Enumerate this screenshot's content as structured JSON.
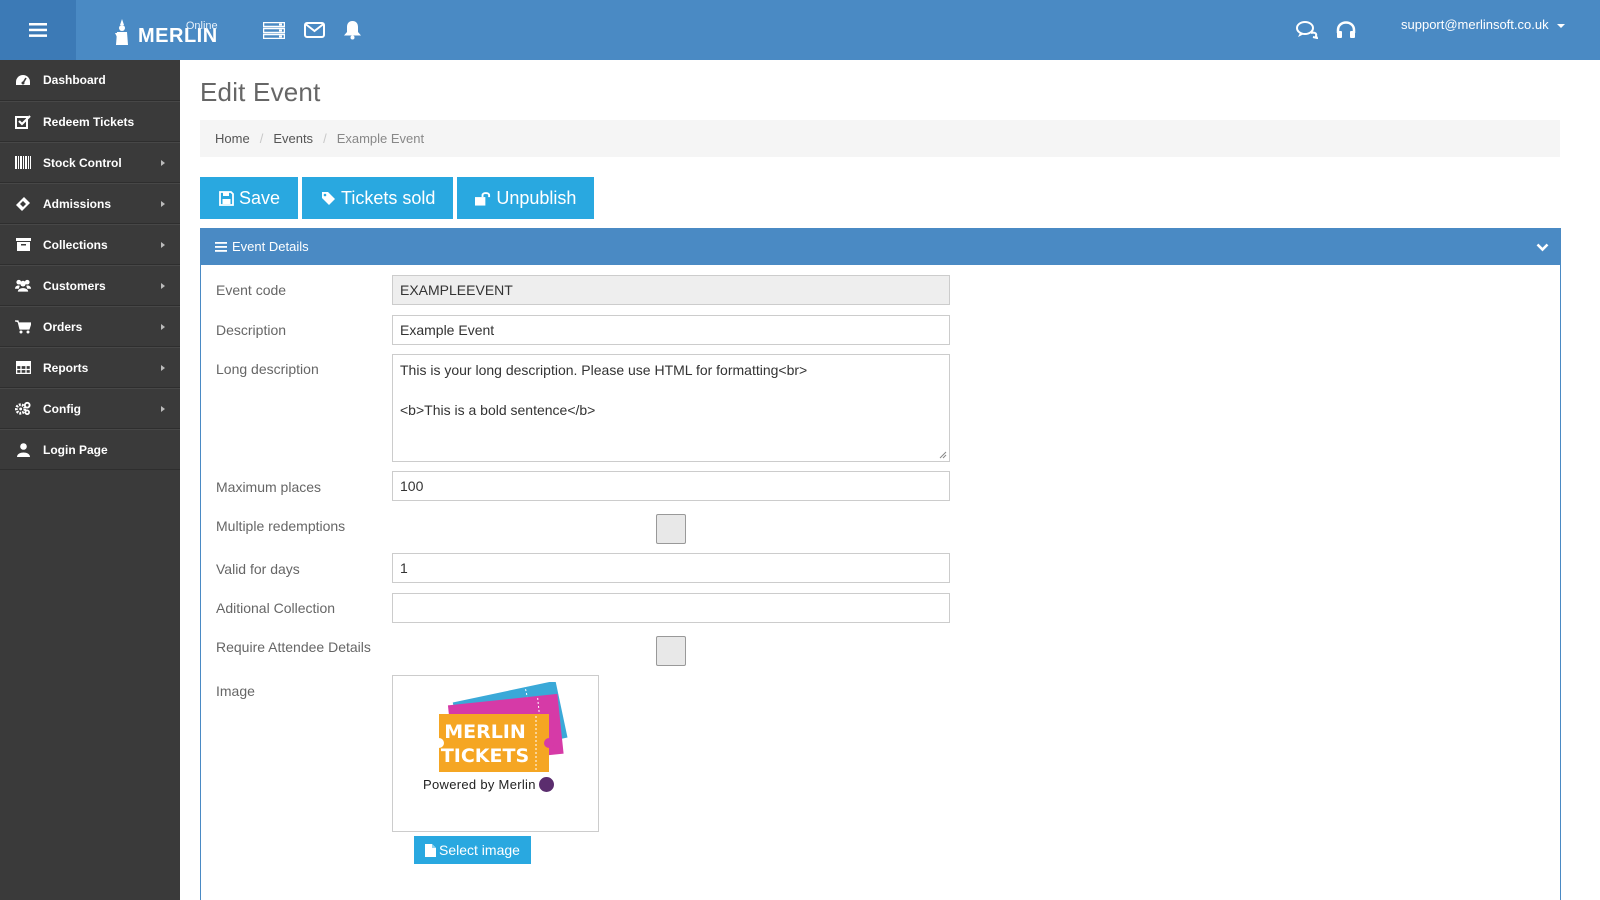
{
  "header": {
    "logo_text": "MERLIN",
    "logo_sub": "Online",
    "user_email": "support@merlinsoft.co.uk",
    "accent_color": "#4a8ac4"
  },
  "sidebar": {
    "items": [
      {
        "label": "Dashboard",
        "icon": "dashboard-icon",
        "has_submenu": false
      },
      {
        "label": "Redeem Tickets",
        "icon": "check-square-icon",
        "has_submenu": false
      },
      {
        "label": "Stock Control",
        "icon": "barcode-icon",
        "has_submenu": true
      },
      {
        "label": "Admissions",
        "icon": "ticket-icon",
        "has_submenu": true
      },
      {
        "label": "Collections",
        "icon": "archive-icon",
        "has_submenu": true
      },
      {
        "label": "Customers",
        "icon": "users-icon",
        "has_submenu": true
      },
      {
        "label": "Orders",
        "icon": "cart-icon",
        "has_submenu": true
      },
      {
        "label": "Reports",
        "icon": "table-icon",
        "has_submenu": true
      },
      {
        "label": "Config",
        "icon": "cogs-icon",
        "has_submenu": true
      },
      {
        "label": "Login Page",
        "icon": "user-icon",
        "has_submenu": false
      }
    ]
  },
  "page": {
    "title": "Edit Event",
    "breadcrumb": [
      "Home",
      "Events",
      "Example Event"
    ]
  },
  "toolbar": {
    "save_label": "Save",
    "tickets_label": "Tickets sold",
    "unpublish_label": "Unpublish",
    "button_color": "#29a8e0"
  },
  "panel": {
    "title": "Event Details"
  },
  "form": {
    "event_code": {
      "label": "Event code",
      "value": "EXAMPLEEVENT"
    },
    "description": {
      "label": "Description",
      "value": "Example Event"
    },
    "long_description": {
      "label": "Long description",
      "line1": "This is your long description. Please use HTML for formatting<br>",
      "line2": "<b>This is a bold sentence</b>"
    },
    "maximum_places": {
      "label": "Maximum places",
      "value": "100"
    },
    "multiple_redemptions": {
      "label": "Multiple redemptions",
      "checked": false
    },
    "valid_for_days": {
      "label": "Valid for days",
      "value": "1"
    },
    "additional_collection": {
      "label": "Aditional Collection",
      "value": ""
    },
    "require_attendee": {
      "label": "Require Attendee Details",
      "checked": false
    },
    "image": {
      "label": "Image",
      "logo_line1": "MERLIN",
      "logo_line2": "TICKETS",
      "powered_by": "Powered by Merlin",
      "select_label": "Select image"
    }
  }
}
